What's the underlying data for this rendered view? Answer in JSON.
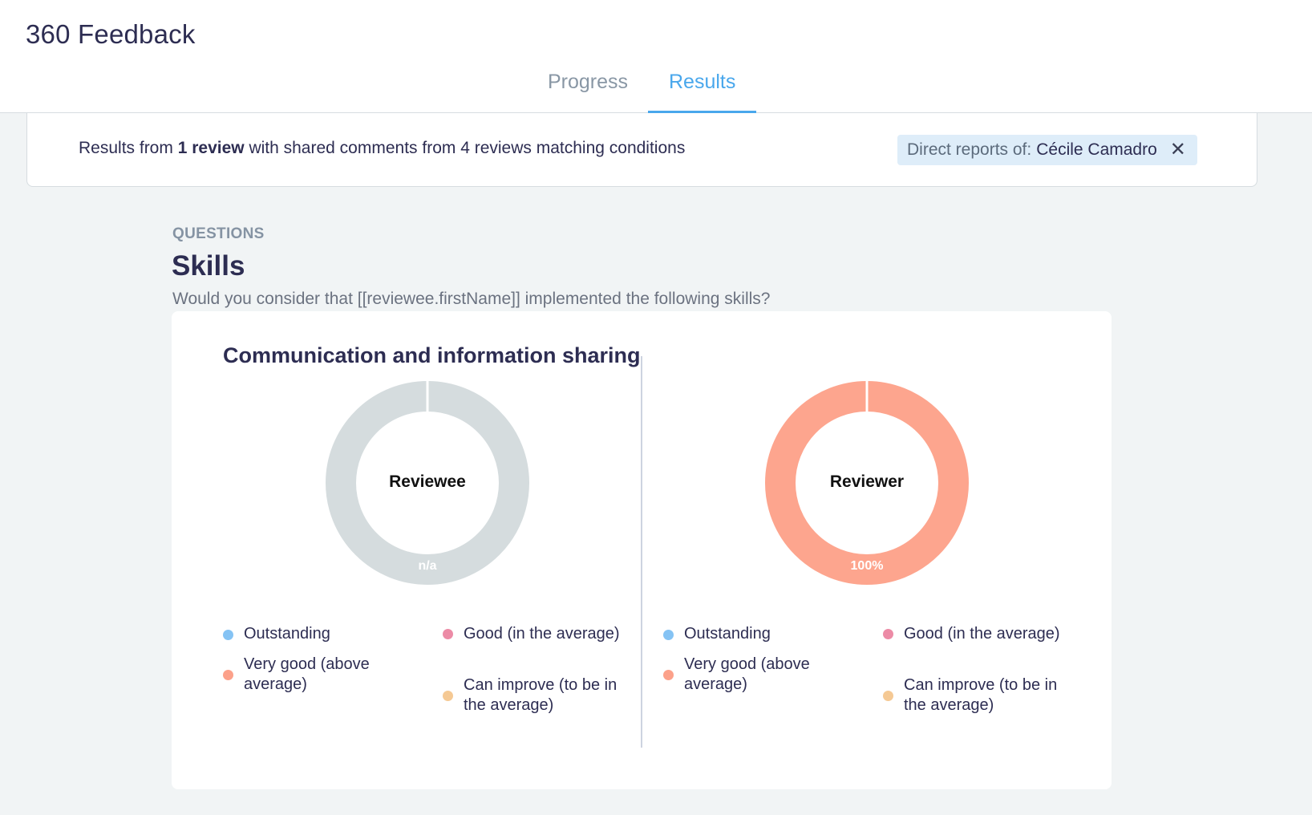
{
  "app": {
    "title": "360 Feedback"
  },
  "tabs": [
    {
      "label": "Progress",
      "active": false
    },
    {
      "label": "Results",
      "active": true
    }
  ],
  "filter": {
    "summary_prefix": "Results from ",
    "summary_bold": "1 review",
    "summary_suffix": " with shared comments from 4 reviews matching conditions",
    "chip_key": "Direct reports of:",
    "chip_value": "Cécile Camadro",
    "chip_close_icon": "close-icon"
  },
  "section": {
    "label": "QUESTIONS",
    "title": "Skills",
    "description": "Would you consider that [[reviewee.firstName]] implemented the following skills?"
  },
  "question": {
    "title": "Communication and information sharing",
    "panels": [
      {
        "label": "Reviewee",
        "value_text": "n/a",
        "fill_color": "#d5dcde"
      },
      {
        "label": "Reviewer",
        "value_text": "100%",
        "fill_color": "#fda58e"
      }
    ],
    "legend": [
      {
        "label": "Outstanding",
        "color": "#85c3f4"
      },
      {
        "label": "Very good (above average)",
        "color": "#fca18a"
      },
      {
        "label": "Good (in the average)",
        "color": "#ec8ba6"
      },
      {
        "label": "Can improve (to be in the average)",
        "color": "#f5c994"
      }
    ]
  },
  "colors": {
    "accent": "#49a7ec",
    "text": "#2d2d52"
  }
}
